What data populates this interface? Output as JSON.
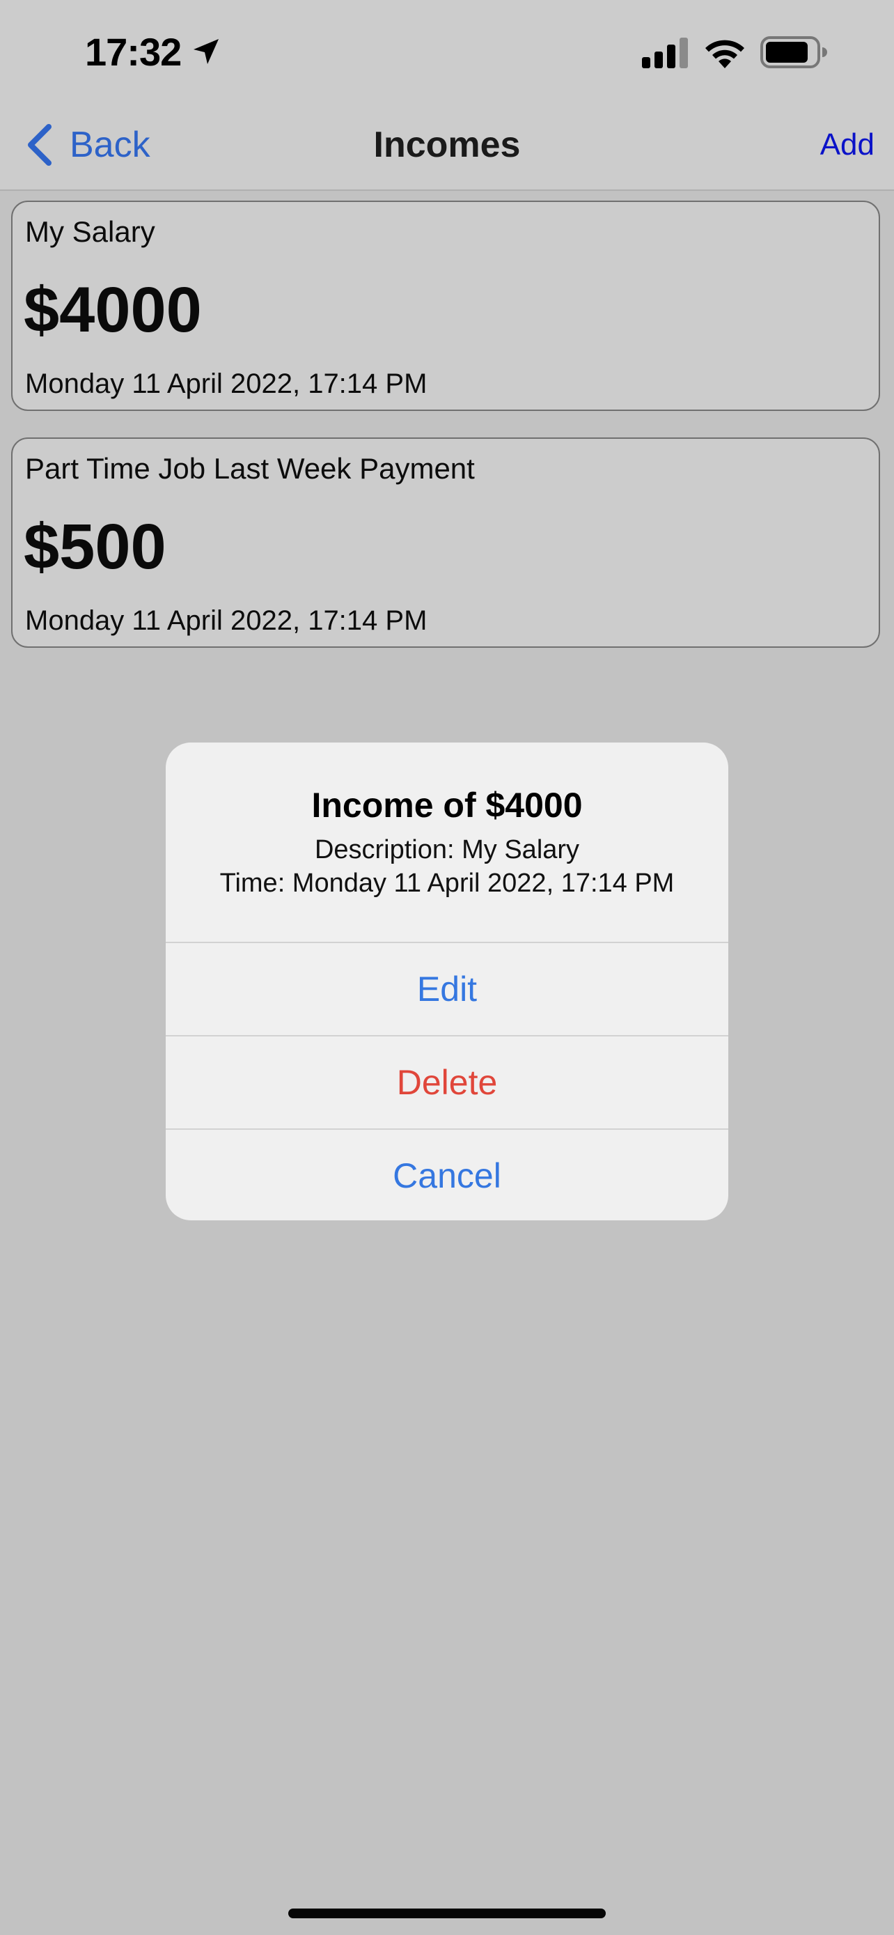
{
  "status_bar": {
    "time": "17:32",
    "icons": [
      "location-arrow-icon",
      "cellular-signal-icon",
      "wifi-icon",
      "battery-icon"
    ]
  },
  "nav": {
    "back_label": "Back",
    "title": "Incomes",
    "add_label": "Add"
  },
  "incomes": [
    {
      "description": "My Salary",
      "amount": "$4000",
      "time": "Monday 11 April 2022, 17:14 PM"
    },
    {
      "description": "Part Time Job Last Week Payment",
      "amount": "$500",
      "time": "Monday 11 April 2022, 17:14 PM"
    }
  ],
  "alert": {
    "title": "Income of $4000",
    "description_line": "Description: My Salary",
    "time_line": "Time: Monday 11 April 2022, 17:14 PM",
    "actions": {
      "edit": "Edit",
      "delete": "Delete",
      "cancel": "Cancel"
    }
  },
  "colors": {
    "accent_blue": "#3577e0",
    "destructive_red": "#e0463a",
    "add_blue": "#0a12c8",
    "dimmed_background": "#c2c2c2"
  }
}
